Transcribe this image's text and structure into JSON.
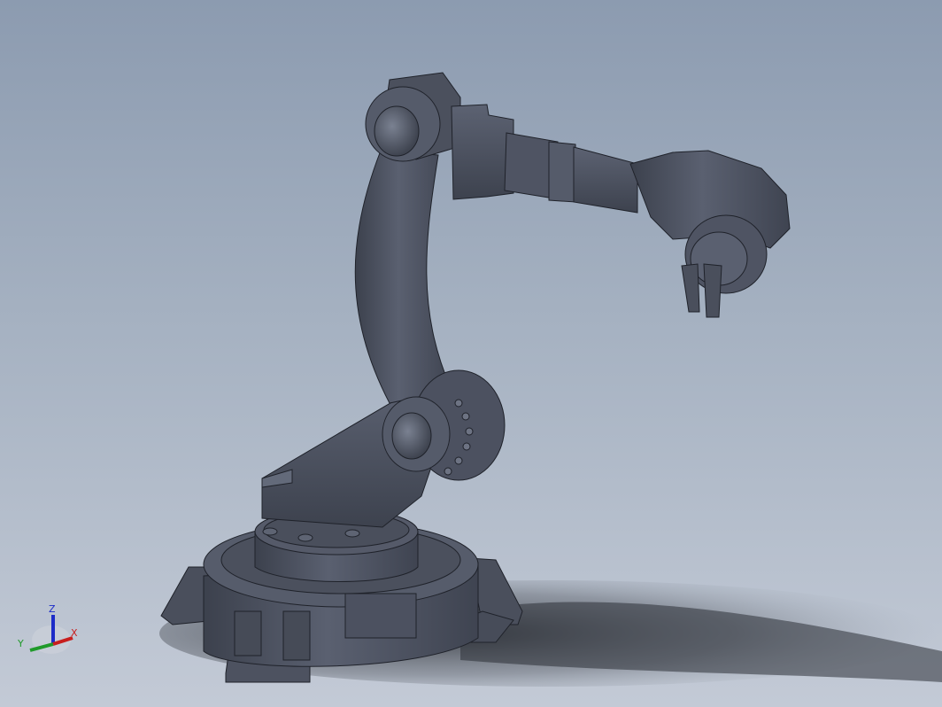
{
  "viewport": {
    "model": "robot-arm",
    "background_top": "#8c9bb0",
    "background_bottom": "#c3cad6",
    "model_color": "#4f5565",
    "edge_color": "#1f222a"
  },
  "triad": {
    "z_label": "Z",
    "y_label": "Y",
    "x_label": "X",
    "z_color": "#1d2cc8",
    "y_color": "#1f9a2a",
    "x_color": "#c81e1e"
  }
}
